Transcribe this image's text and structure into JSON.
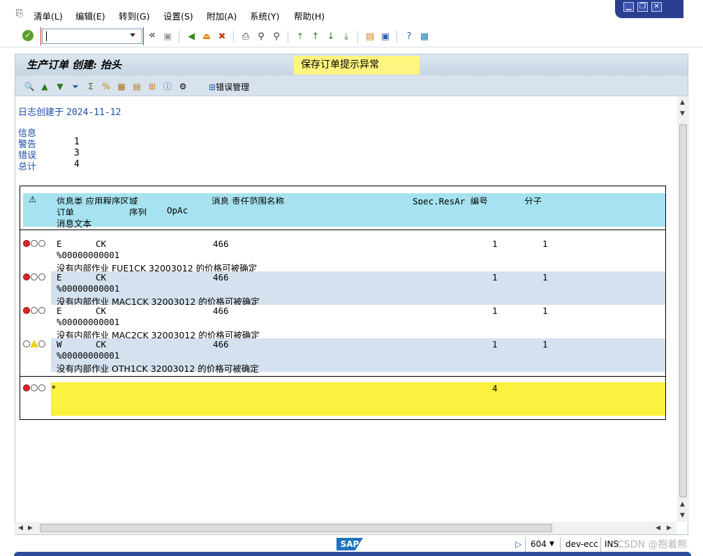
{
  "menu": {
    "items": [
      "清单(L)",
      "编辑(E)",
      "转到(G)",
      "设置(S)",
      "附加(A)",
      "系统(Y)",
      "帮助(H)"
    ]
  },
  "window_controls": {
    "minimize": "▁",
    "restore": "❐",
    "close": "✕"
  },
  "toolbar": {
    "command_value": "",
    "icons": [
      "check-icon",
      "command-field",
      "back-fast-icon",
      "save-icon",
      "back-icon",
      "exit-icon",
      "cancel-icon",
      "print-icon",
      "find-icon",
      "find-next-icon",
      "first-page-icon",
      "previous-page-icon",
      "next-page-icon",
      "last-page-icon",
      "create-session-icon",
      "shortcut-icon",
      "help-icon",
      "layout-icon"
    ]
  },
  "header": {
    "title": "生产订单 创建: 抬头",
    "alert": "保存订单提示异常"
  },
  "app_toolbar": {
    "error_mgmt_label": "错误管理"
  },
  "log": {
    "date_label": "日志创建于",
    "date": "2024-11-12",
    "summary": [
      {
        "label": "信息",
        "value": ""
      },
      {
        "label": "警告",
        "value": "1"
      },
      {
        "label": "错误",
        "value": "3"
      },
      {
        "label": "总计",
        "value": "4"
      }
    ]
  },
  "grid": {
    "header_row1": {
      "warn_icon": "⚠",
      "col1": "信息类 应用程序区域",
      "col2": "消息 责任范围名称",
      "col3": "Spec.ResAr 编号",
      "col4": "分子"
    },
    "header_row2": {
      "col1": "订单",
      "col2": "序列",
      "col3": "OpAc"
    },
    "header_row3": {
      "col1": "消息文本"
    },
    "rows": [
      {
        "status": "error",
        "type": "E",
        "area": "CK",
        "msg": "466",
        "num": "1",
        "den": "1",
        "order": "%00000000001",
        "text": "没有内部作业 FUE1CK 32003012 的价格可被确定"
      },
      {
        "status": "error",
        "type": "E",
        "area": "CK",
        "msg": "466",
        "num": "1",
        "den": "1",
        "order": "%00000000001",
        "text": "没有内部作业 MAC1CK 32003012 的价格可被确定"
      },
      {
        "status": "error",
        "type": "E",
        "area": "CK",
        "msg": "466",
        "num": "1",
        "den": "1",
        "order": "%00000000001",
        "text": "没有内部作业 MAC2CK 32003012 的价格可被确定"
      },
      {
        "status": "warning",
        "type": "W",
        "area": "CK",
        "msg": "466",
        "num": "1",
        "den": "1",
        "order": "%00000000001",
        "text": "没有内部作业 OTH1CK 32003012 的价格可被确定"
      }
    ],
    "total": {
      "marker": "*",
      "count": "4"
    }
  },
  "status_bar": {
    "session": "604",
    "system": "dev-ecc",
    "mode": "INS",
    "watermark": "CSDN @抱着熊"
  }
}
